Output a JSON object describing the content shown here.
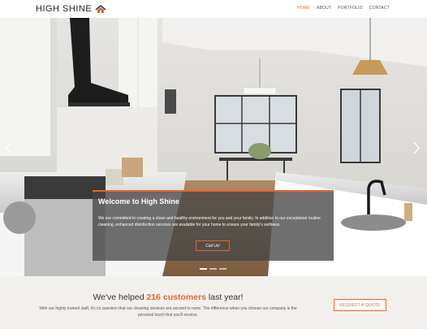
{
  "brand": {
    "name": "HIGH SHINE",
    "accent": "#e2672b"
  },
  "nav": [
    {
      "label": "HOME",
      "active": true
    },
    {
      "label": "ABOUT",
      "active": false
    },
    {
      "label": "PORTFOLIO",
      "active": false
    },
    {
      "label": "CONTACT",
      "active": false
    }
  ],
  "hero": {
    "title": "Welcome to High Shine",
    "text": "We are committed to creating a clean and healthy environment for you and your family. In addition to our exceptional routine cleaning, enhanced disinfection services are available for your home to ensure your family's wellness.",
    "button": "Call Us!",
    "prev_icon": "chevron-left-icon",
    "next_icon": "chevron-right-icon",
    "slides": 3
  },
  "cta": {
    "head_before": "We've helped ",
    "head_highlight": "216 customers",
    "head_after": " last year!",
    "sub": "With our highly trained staff, it's no question that our cleaning services are second to none. The difference when you choose our company is the personal touch that you'll receive.",
    "button": "REQUEST A QUOTE"
  }
}
